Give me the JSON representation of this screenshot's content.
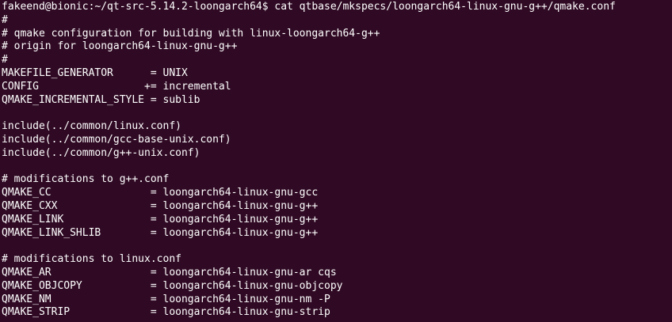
{
  "terminal": {
    "prompt": "fakeend@bionic:~/qt-src-5.14.2-loongarch64$ ",
    "command": "cat qtbase/mkspecs/loongarch64-linux-gnu-g++/qmake.conf",
    "output": [
      "#",
      "# qmake configuration for building with linux-loongarch64-g++",
      "# origin for loongarch64-linux-gnu-g++",
      "#",
      "MAKEFILE_GENERATOR      = UNIX",
      "CONFIG                 += incremental",
      "QMAKE_INCREMENTAL_STYLE = sublib",
      "",
      "include(../common/linux.conf)",
      "include(../common/gcc-base-unix.conf)",
      "include(../common/g++-unix.conf)",
      "",
      "# modifications to g++.conf",
      "QMAKE_CC                = loongarch64-linux-gnu-gcc",
      "QMAKE_CXX               = loongarch64-linux-gnu-g++",
      "QMAKE_LINK              = loongarch64-linux-gnu-g++",
      "QMAKE_LINK_SHLIB        = loongarch64-linux-gnu-g++",
      "",
      "# modifications to linux.conf",
      "QMAKE_AR                = loongarch64-linux-gnu-ar cqs",
      "QMAKE_OBJCOPY           = loongarch64-linux-gnu-objcopy",
      "QMAKE_NM                = loongarch64-linux-gnu-nm -P",
      "QMAKE_STRIP             = loongarch64-linux-gnu-strip"
    ]
  },
  "colors": {
    "background": "#300a24",
    "text": "#ffffff"
  }
}
